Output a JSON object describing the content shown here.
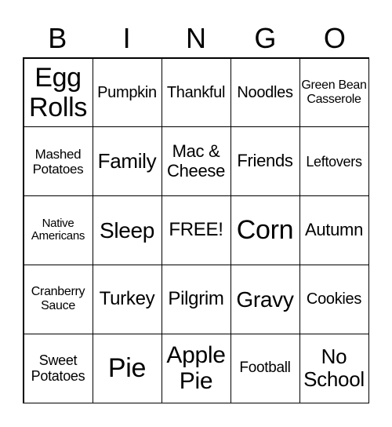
{
  "header": [
    "B",
    "I",
    "N",
    "G",
    "O"
  ],
  "cells": [
    "Egg Rolls",
    "Pumpkin",
    "Thankful",
    "Noodles",
    "Green Bean Casserole",
    "Mashed Potatoes",
    "Family",
    "Mac & Cheese",
    "Friends",
    "Leftovers",
    "Native Americans",
    "Sleep",
    "FREE!",
    "Corn",
    "Autumn",
    "Cranberry Sauce",
    "Turkey",
    "Pilgrim",
    "Gravy",
    "Cookies",
    "Sweet Potatoes",
    "Pie",
    "Apple Pie",
    "Football",
    "No School"
  ]
}
